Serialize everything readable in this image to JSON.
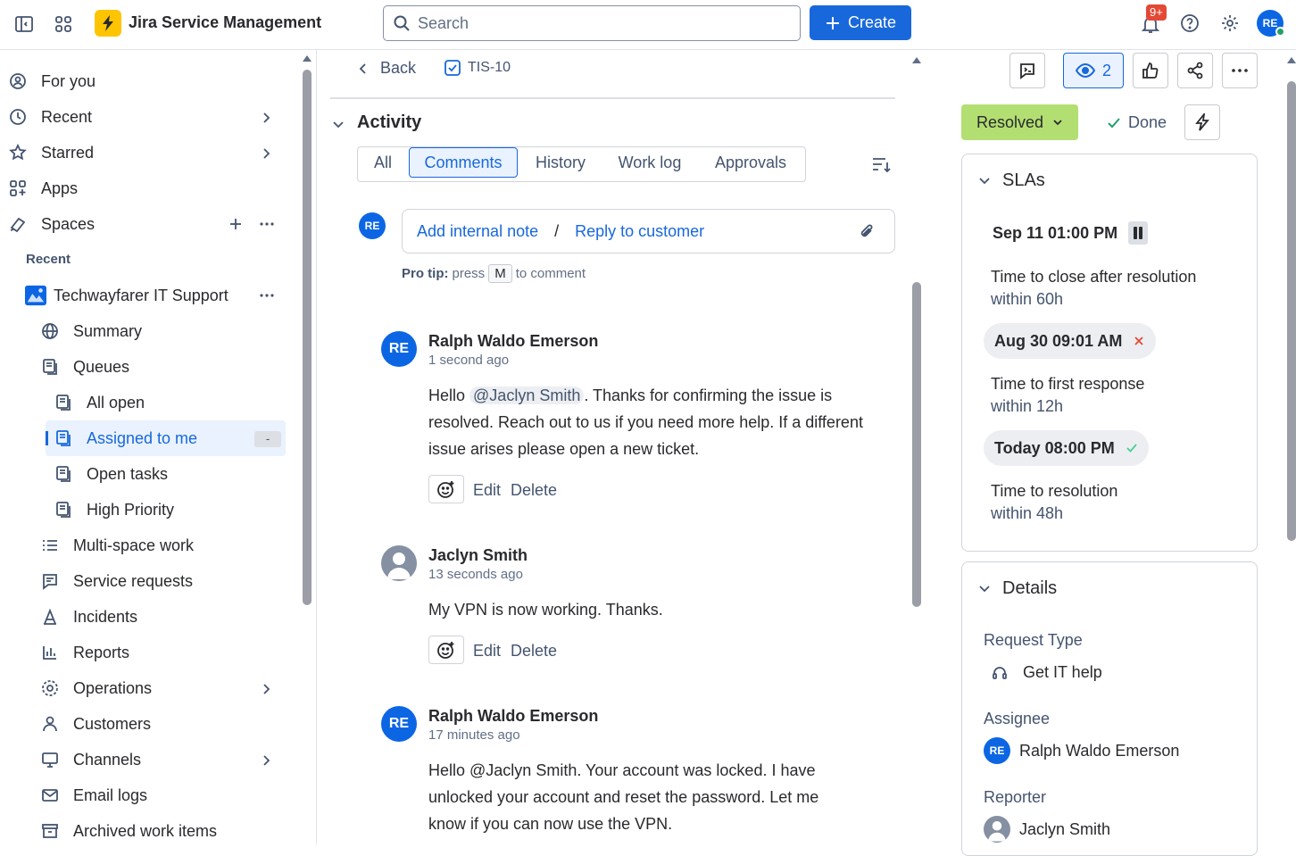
{
  "topbar": {
    "app_title": "Jira Service Management",
    "search_placeholder": "Search",
    "create_label": "Create",
    "notif_count": "9+",
    "user_initials": "RE"
  },
  "sidebar": {
    "for_you": "For you",
    "recent": "Recent",
    "starred": "Starred",
    "apps": "Apps",
    "spaces": "Spaces",
    "recent_header": "Recent",
    "project": "Techwayfarer IT Support",
    "summary": "Summary",
    "queues": "Queues",
    "all_open": "All open",
    "assigned_to_me": "Assigned to me",
    "assigned_badge": "-",
    "open_tasks": "Open tasks",
    "high_priority": "High Priority",
    "multi_space": "Multi-space work",
    "service_requests": "Service requests",
    "incidents": "Incidents",
    "reports": "Reports",
    "operations": "Operations",
    "customers": "Customers",
    "channels": "Channels",
    "email_logs": "Email logs",
    "archived": "Archived work items"
  },
  "main": {
    "back": "Back",
    "issue_key": "TIS-10",
    "activity_title": "Activity",
    "tabs": [
      "All",
      "Comments",
      "History",
      "Work log",
      "Approvals"
    ],
    "active_tab": "Comments",
    "commenter_initials": "RE",
    "add_internal_note": "Add internal note",
    "separator": "/",
    "reply_to_customer": "Reply to customer",
    "pro_tip_label": "Pro tip:",
    "pro_tip_press": "press",
    "pro_tip_key": "M",
    "pro_tip_rest": "to comment",
    "comments": [
      {
        "author": "Ralph Waldo Emerson",
        "initials": "RE",
        "time": "1 second ago",
        "body_prefix": "Hello ",
        "mention": "@Jaclyn Smith",
        "body_suffix": ". Thanks for confirming the issue is resolved. Reach out to us if you need more help. If a different issue arises please open a new ticket.",
        "edit": "Edit",
        "delete": "Delete"
      },
      {
        "author": "Jaclyn Smith",
        "initials": "",
        "time": "13 seconds ago",
        "body": "My VPN is now working. Thanks.",
        "edit": "Edit",
        "delete": "Delete"
      },
      {
        "author": "Ralph Waldo Emerson",
        "initials": "RE",
        "time": "17 minutes ago",
        "body": "Hello @Jaclyn Smith. Your account was locked. I have unlocked your account and reset the password. Let me know if you can now use the VPN."
      }
    ]
  },
  "right": {
    "watch_count": "2",
    "status": "Resolved",
    "done": "Done",
    "slas_title": "SLAs",
    "slas": [
      {
        "date": "Sep 11 01:00 PM",
        "label": "Time to close after resolution",
        "sub": "within 60h",
        "state": "paused"
      },
      {
        "date": "Aug 30 09:01 AM",
        "label": "Time to first response",
        "sub": "within 12h",
        "state": "breached"
      },
      {
        "date": "Today 08:00 PM",
        "label": "Time to resolution",
        "sub": "within 48h",
        "state": "met"
      }
    ],
    "details_title": "Details",
    "request_type_label": "Request Type",
    "request_type": "Get IT help",
    "assignee_label": "Assignee",
    "assignee": "Ralph Waldo Emerson",
    "assignee_initials": "RE",
    "reporter_label": "Reporter",
    "reporter": "Jaclyn Smith"
  },
  "colors": {
    "accent": "#1868db",
    "resolved_bg": "#b3df72",
    "breach": "#e34935",
    "met": "#4bce97"
  }
}
